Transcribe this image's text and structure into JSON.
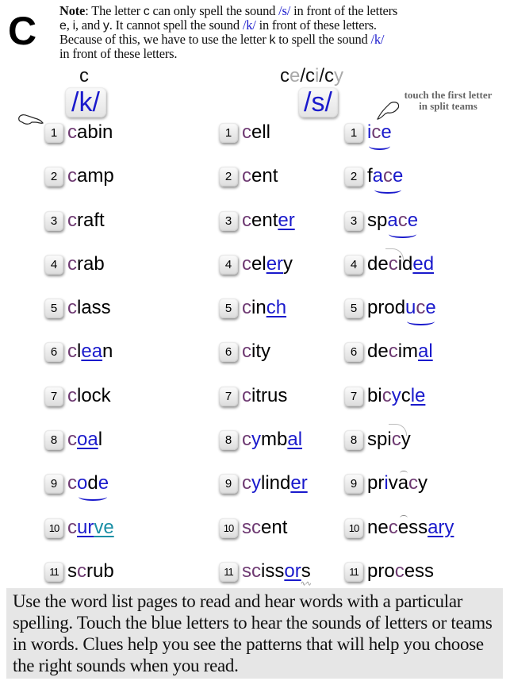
{
  "page": {
    "letter": "C",
    "note": {
      "label": "Note",
      "line1_a": ": The letter ",
      "line1_c": "c",
      "line1_b": " can only spell the sound ",
      "line1_ph": "/s/",
      "line1_d": " in front of the letters",
      "line2_e": "e",
      "line2_a": ", ",
      "line2_i": "i",
      "line2_b": ", and ",
      "line2_y": "y",
      "line2_c": ". It cannot spell the sound ",
      "line2_ph": "/k/",
      "line2_d": " in front of these letters.",
      "line3_a": "Because of this, we have to use the letter ",
      "line3_k": "k",
      "line3_b": " to spell the sound ",
      "line3_ph": "/k/",
      "line4": "in front of these letters."
    },
    "hint": {
      "line1": "touch the first letter",
      "line2": "in split teams"
    },
    "footer": "Use the word list pages to read and hear words with a particular spelling. Touch the blue letters to hear the sounds of letters or teams in words. Clues help you see the patterns that will help you choose the right sounds when you read."
  },
  "columns": [
    {
      "heading": [
        "c"
      ],
      "sound": "/k/",
      "words": [
        "cabin",
        "camp",
        "craft",
        "crab",
        "class",
        "clean",
        "clock",
        "coal",
        "code",
        "curve",
        "scrub"
      ]
    },
    {
      "heading": [
        "c",
        "e",
        "/",
        "c",
        "i",
        "/",
        "c",
        "y"
      ],
      "sound": "/s/",
      "words": [
        "cell",
        "cent",
        "center",
        "celery",
        "cinch",
        "city",
        "citrus",
        "cymbal",
        "cylinder",
        "scent",
        "scissors"
      ]
    },
    {
      "heading": [],
      "sound": "",
      "words": [
        "ice",
        "face",
        "space",
        "decided",
        "produce",
        "decimal",
        "bicycle",
        "spicy",
        "privacy",
        "necessary",
        "process"
      ]
    }
  ],
  "colors": {
    "target_c": "#6e3a72",
    "sound_blue": "#1a1acc",
    "teal": "#1a8fa5",
    "footer_bg": "#e6e6e6",
    "muted_heading": "#aaaaaa"
  },
  "segments": {
    "c0": [
      [
        {
          "t": "c",
          "k": "p"
        },
        {
          "t": "abin"
        }
      ],
      [
        {
          "t": "c",
          "k": "p"
        },
        {
          "t": "amp"
        }
      ],
      [
        {
          "t": "c",
          "k": "p"
        },
        {
          "t": "raft"
        }
      ],
      [
        {
          "t": "c",
          "k": "p"
        },
        {
          "t": "rab"
        }
      ],
      [
        {
          "t": "c",
          "k": "p"
        },
        {
          "t": "lass"
        }
      ],
      [
        {
          "t": "c",
          "k": "p"
        },
        {
          "t": "l"
        },
        {
          "t": "ea",
          "k": "bu"
        },
        {
          "t": "n"
        }
      ],
      [
        {
          "t": "c",
          "k": "p"
        },
        {
          "t": "lock"
        }
      ],
      [
        {
          "t": "c",
          "k": "p"
        },
        {
          "t": "oa",
          "k": "bu"
        },
        {
          "t": "l"
        }
      ],
      [
        {
          "t": "c",
          "k": "p"
        },
        {
          "t": "o",
          "k": "b",
          "smile": true
        },
        {
          "t": "d"
        },
        {
          "t": "e",
          "k": "b"
        }
      ],
      [
        {
          "t": "c",
          "k": "p"
        },
        {
          "t": "ur",
          "k": "bu"
        },
        {
          "t": "ve",
          "k": "tu"
        }
      ],
      [
        {
          "t": "s"
        },
        {
          "t": "c",
          "k": "p"
        },
        {
          "t": "rub"
        }
      ]
    ],
    "c1": [
      [
        {
          "t": "c",
          "k": "p"
        },
        {
          "t": "ell"
        }
      ],
      [
        {
          "t": "c",
          "k": "p"
        },
        {
          "t": "ent"
        }
      ],
      [
        {
          "t": "c",
          "k": "p"
        },
        {
          "t": "ent"
        },
        {
          "t": "er",
          "k": "bu"
        }
      ],
      [
        {
          "t": "c",
          "k": "p"
        },
        {
          "t": "el"
        },
        {
          "t": "er",
          "k": "bu"
        },
        {
          "t": "y"
        }
      ],
      [
        {
          "t": "c",
          "k": "p"
        },
        {
          "t": "in"
        },
        {
          "t": "ch",
          "k": "bu"
        }
      ],
      [
        {
          "t": "c",
          "k": "p"
        },
        {
          "t": "ity"
        }
      ],
      [
        {
          "t": "c",
          "k": "p"
        },
        {
          "t": "itrus"
        }
      ],
      [
        {
          "t": "c",
          "k": "p"
        },
        {
          "t": "y",
          "k": "b"
        },
        {
          "t": "mb"
        },
        {
          "t": "al",
          "k": "bu"
        }
      ],
      [
        {
          "t": "c",
          "k": "p"
        },
        {
          "t": "y",
          "k": "b"
        },
        {
          "t": "lind"
        },
        {
          "t": "er",
          "k": "bu"
        }
      ],
      [
        {
          "t": "sc",
          "k": "p"
        },
        {
          "t": "ent"
        }
      ],
      [
        {
          "t": "sc",
          "k": "p"
        },
        {
          "t": "iss"
        },
        {
          "t": "or",
          "k": "bu"
        },
        {
          "t": "s",
          "squig": true
        }
      ]
    ],
    "c2": [
      [
        {
          "t": "i",
          "k": "b",
          "smile": true
        },
        {
          "t": "c",
          "k": "p"
        },
        {
          "t": "e",
          "k": "b"
        }
      ],
      [
        {
          "t": "f"
        },
        {
          "t": "a",
          "k": "b",
          "smile": true
        },
        {
          "t": "c",
          "k": "p"
        },
        {
          "t": "e",
          "k": "b"
        }
      ],
      [
        {
          "t": "sp"
        },
        {
          "t": "a",
          "k": "b",
          "smile": true
        },
        {
          "t": "c",
          "k": "p"
        },
        {
          "t": "e",
          "k": "b"
        }
      ],
      [
        {
          "t": "de"
        },
        {
          "t": "c",
          "k": "p",
          "swoop": true
        },
        {
          "t": "id"
        },
        {
          "t": "ed",
          "k": "bu"
        }
      ],
      [
        {
          "t": "prod"
        },
        {
          "t": "u",
          "k": "b",
          "smile": true
        },
        {
          "t": "c",
          "k": "p"
        },
        {
          "t": "e",
          "k": "b"
        }
      ],
      [
        {
          "t": "de"
        },
        {
          "t": "c",
          "k": "p"
        },
        {
          "t": "im"
        },
        {
          "t": "al",
          "k": "bu"
        }
      ],
      [
        {
          "t": "bi"
        },
        {
          "t": "c",
          "k": "p"
        },
        {
          "t": "y",
          "k": "b"
        },
        {
          "t": "c"
        },
        {
          "t": "le",
          "k": "bu"
        }
      ],
      [
        {
          "t": "spi"
        },
        {
          "t": "c",
          "k": "p",
          "swoop": true
        },
        {
          "t": "y"
        }
      ],
      [
        {
          "t": "pr"
        },
        {
          "t": "i",
          "k": "b"
        },
        {
          "t": "v"
        },
        {
          "t": "a",
          "breve": true
        },
        {
          "t": "c",
          "k": "p"
        },
        {
          "t": "y"
        }
      ],
      [
        {
          "t": "ne"
        },
        {
          "t": "c",
          "k": "p"
        },
        {
          "t": "e",
          "breve": true
        },
        {
          "t": "ss"
        },
        {
          "t": "ary",
          "k": "bu"
        }
      ],
      [
        {
          "t": "pro"
        },
        {
          "t": "c",
          "k": "p"
        },
        {
          "t": "ess"
        }
      ]
    ]
  }
}
